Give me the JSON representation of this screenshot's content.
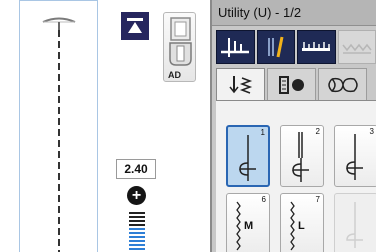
{
  "left_panel": {
    "foot_code": "AD",
    "stitch_width": "2.40",
    "plus_symbol": "+"
  },
  "right_panel": {
    "title": "Utility (U) - 1/2",
    "category_tabs": [
      {
        "icon": "utility-stitches-icon",
        "active": true
      },
      {
        "icon": "needle-icon",
        "active": true
      },
      {
        "icon": "ruler-icon",
        "active": true
      },
      {
        "icon": "decorative-stitches-icon",
        "active": false
      }
    ],
    "sub_tabs": [
      {
        "icon": "straight-stitch-tab-icon",
        "active": true
      },
      {
        "icon": "buttonhole-tab-icon",
        "active": false
      },
      {
        "icon": "decorative-tab-icon",
        "active": false
      }
    ],
    "stitches": [
      {
        "num": "1",
        "letter": "",
        "selected": true
      },
      {
        "num": "2",
        "letter": "",
        "selected": false
      },
      {
        "num": "3",
        "letter": "",
        "selected": false
      },
      {
        "num": "6",
        "letter": "M",
        "selected": false
      },
      {
        "num": "7",
        "letter": "L",
        "selected": false
      },
      {
        "num": "",
        "letter": "",
        "selected": false,
        "disabled": true
      }
    ]
  },
  "colors": {
    "accent_navy": "#1f2a55",
    "selected_blue": "#2a66b3",
    "panel_gray": "#c8c8c8"
  }
}
